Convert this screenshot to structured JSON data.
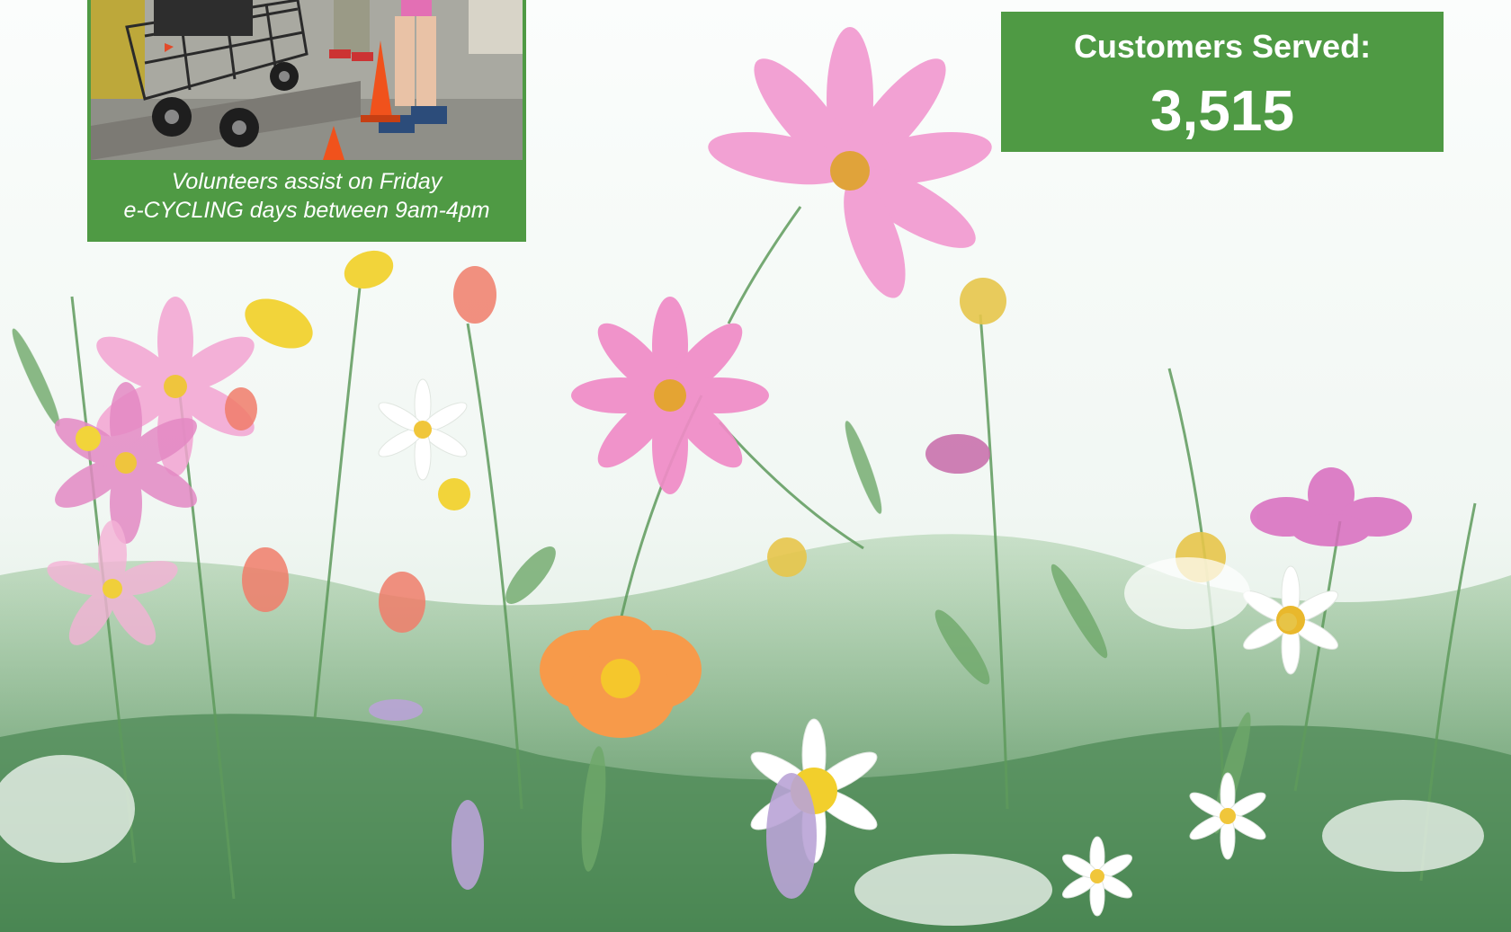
{
  "photo_card": {
    "caption_line1": "Volunteers assist on Friday",
    "caption_line2": "e-CYCLING days between 9am-4pm"
  },
  "stat_card": {
    "label": "Customers Served:",
    "value": "3,515"
  },
  "colors": {
    "card_green": "#4f9a44",
    "text_white": "#ffffff"
  }
}
